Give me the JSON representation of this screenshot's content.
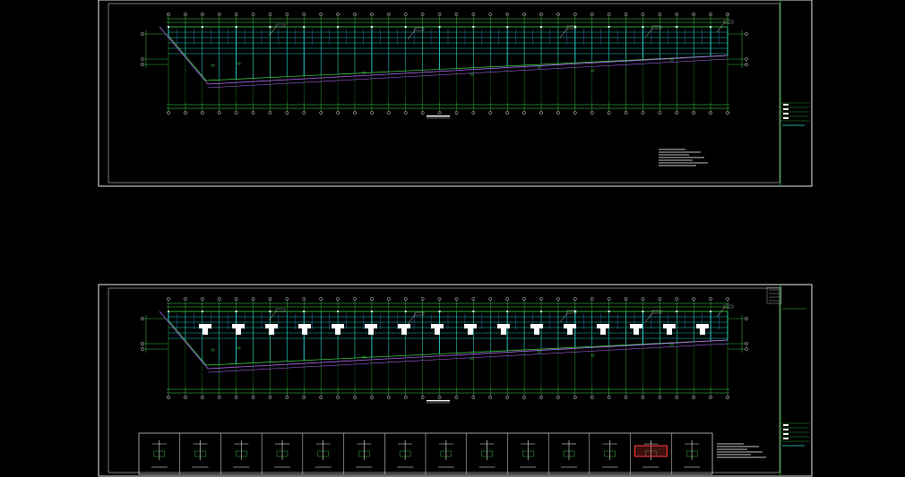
{
  "app": {
    "canvas_background": "#000000"
  },
  "colors": {
    "sheet_border": "#e6e6e6",
    "title_block": "#2fbf3a",
    "axis_grid": "#42d94a",
    "structure": "#27d7d7",
    "beam_blue": "#4ea6ff",
    "slope_line": "#b76cff",
    "columns": "#ffffff",
    "detail_highlight": "#ff3b3b"
  },
  "sheets": [
    {
      "id": "upper",
      "annotations": [],
      "legend_lines": 7
    },
    {
      "id": "lower",
      "annotations": [],
      "legend_lines": 6,
      "detail_panels": 14
    }
  ]
}
